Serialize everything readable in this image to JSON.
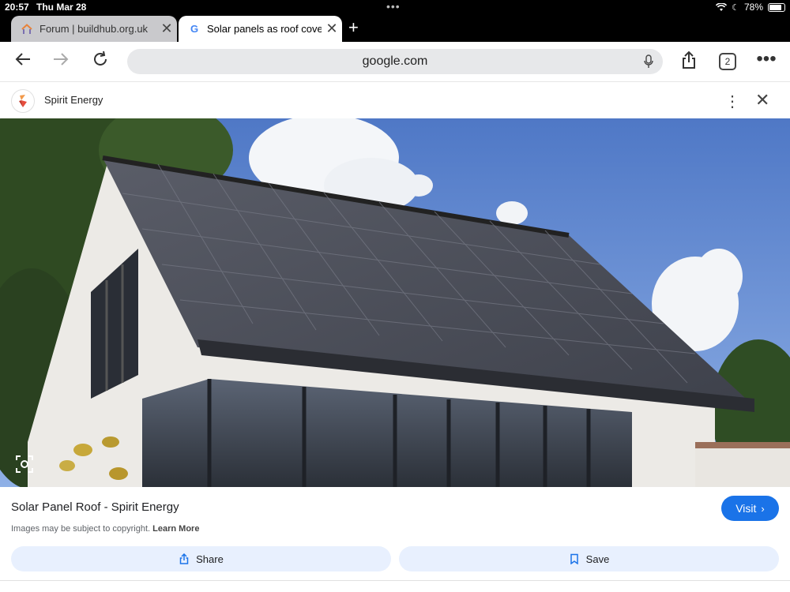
{
  "status": {
    "time": "20:57",
    "date": "Thu Mar 28",
    "battery": "78%"
  },
  "tabs": [
    {
      "label": "Forum | buildhub.org.uk",
      "favicon": "house-icon"
    },
    {
      "label": "Solar panels as roof cove",
      "favicon": "google-icon"
    }
  ],
  "tab_count": "2",
  "address": {
    "url": "google.com"
  },
  "source": {
    "name": "Spirit Energy"
  },
  "result": {
    "title": "Solar Panel Roof - Spirit Energy",
    "visit_label": "Visit",
    "copyright_text": "Images may be subject to copyright.",
    "learn_more": "Learn More",
    "share_label": "Share",
    "save_label": "Save"
  },
  "colors": {
    "accent": "#1a73e8",
    "pill_bg": "#e8f0fe",
    "tab_active": "#ffffff",
    "tab_inactive": "#c9c9cc"
  }
}
